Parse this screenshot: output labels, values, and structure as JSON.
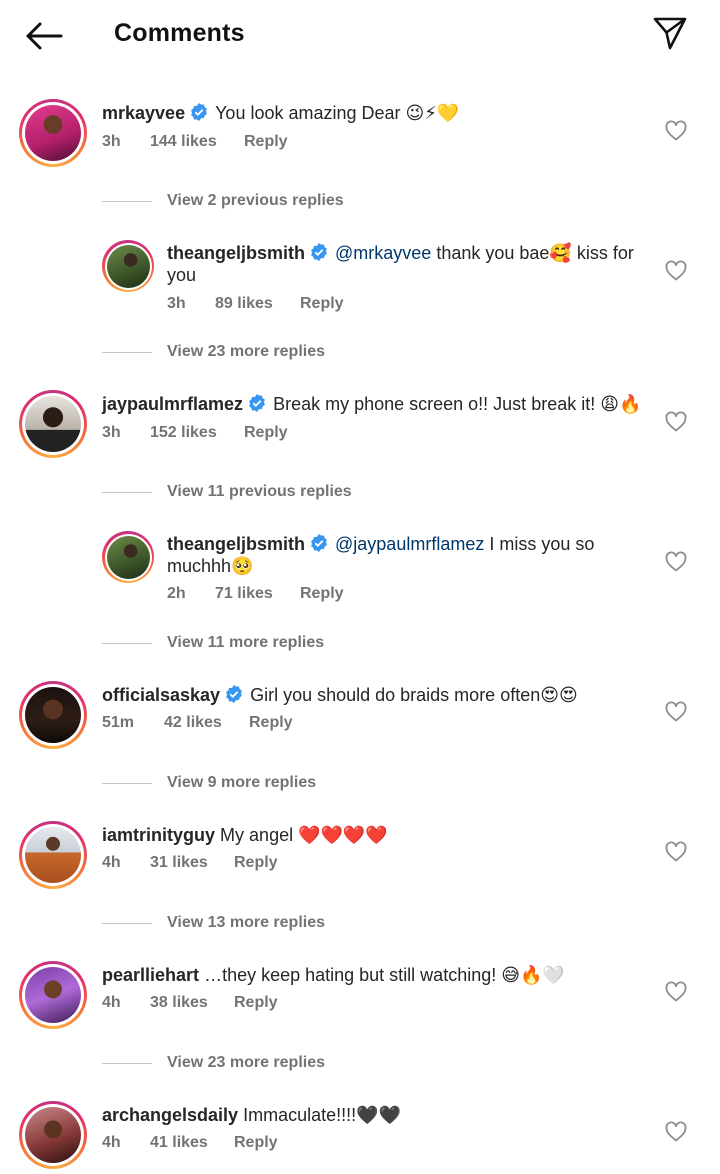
{
  "header": {
    "title": "Comments"
  },
  "colors": {
    "verified": "#3797f0",
    "mention": "#00376b",
    "meta": "#737373"
  },
  "comments": [
    {
      "username": "mrkayvee",
      "text": "You look amazing Dear 😉⚡💛",
      "time": "3h",
      "likes": "144 likes",
      "reply": "Reply",
      "view_replies": "View 2 previous replies"
    },
    {
      "username": "theangeljbsmith",
      "mention": "@mrkayvee",
      "text_line1": " thank you bae🥰 kiss for",
      "text_line2": "you",
      "time": "3h",
      "likes": "89 likes",
      "reply": "Reply",
      "view_replies": "View 23 more replies"
    },
    {
      "username": "jaypaulmrflamez",
      "text": "Break my phone screen o!! Just break it! 😩🔥",
      "time": "3h",
      "likes": "152 likes",
      "reply": "Reply",
      "view_replies": "View 11 previous replies"
    },
    {
      "username": "theangeljbsmith",
      "mention": "@jaypaulmrflamez",
      "text_line1": " I miss you so",
      "text_line2": "muchhh🥺",
      "time": "2h",
      "likes": "71 likes",
      "reply": "Reply",
      "view_replies": "View 11 more replies"
    },
    {
      "username": "officialsaskay",
      "text": "Girl you should do braids more often😍😍",
      "time": "51m",
      "likes": "42 likes",
      "reply": "Reply",
      "view_replies": "View 9 more replies"
    },
    {
      "username": "iamtrinityguy",
      "text": "My angel ❤️❤️❤️❤️",
      "time": "4h",
      "likes": "31 likes",
      "reply": "Reply",
      "view_replies": "View 13 more replies"
    },
    {
      "username": "pearlliehart",
      "text": "…they keep hating but still watching! 😅🔥🤍",
      "time": "4h",
      "likes": "38 likes",
      "reply": "Reply",
      "view_replies": "View 23 more replies"
    },
    {
      "username": "archangelsdaily",
      "text": "Immaculate!!!!🖤🖤",
      "time": "4h",
      "likes": "41 likes",
      "reply": "Reply"
    }
  ]
}
